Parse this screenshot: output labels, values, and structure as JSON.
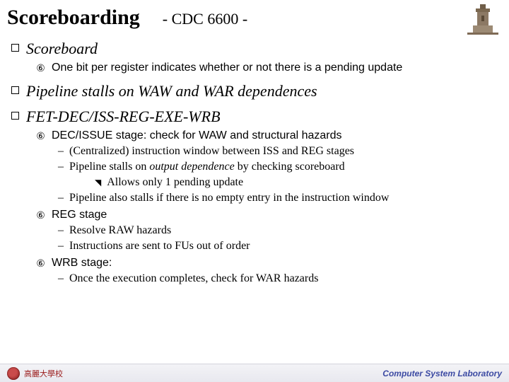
{
  "title": "Scoreboarding",
  "subtitle": "- CDC 6600 -",
  "sections": [
    {
      "heading": "Scoreboard",
      "sub": [
        {
          "text": "One bit per register indicates whether or not there is a pending update"
        }
      ]
    },
    {
      "heading": "Pipeline stalls on WAW and WAR dependences"
    },
    {
      "heading": "FET-DEC/ISS-REG-EXE-WRB",
      "sub": [
        {
          "text": "DEC/ISSUE stage: check for WAW and structural hazards",
          "dash": [
            {
              "text": "(Centralized) instruction window between ISS and REG stages"
            },
            {
              "text_html": "Pipeline stalls on <em class=\"i\">output dependence</em> by checking scoreboard",
              "tri": [
                {
                  "text": "Allows only 1 pending update"
                }
              ]
            },
            {
              "text": "Pipeline also stalls if there is no empty entry in the instruction window"
            }
          ]
        },
        {
          "text": "REG stage",
          "dash": [
            {
              "text": "Resolve RAW hazards"
            },
            {
              "text": "Instructions are sent to FUs out of order"
            }
          ]
        },
        {
          "text": "WRB stage:",
          "dash": [
            {
              "text": "Once the execution completes, check for WAR hazards"
            }
          ]
        }
      ]
    }
  ],
  "footer": {
    "left_text": "高麗大學校",
    "right_text": "Computer System Laboratory"
  }
}
